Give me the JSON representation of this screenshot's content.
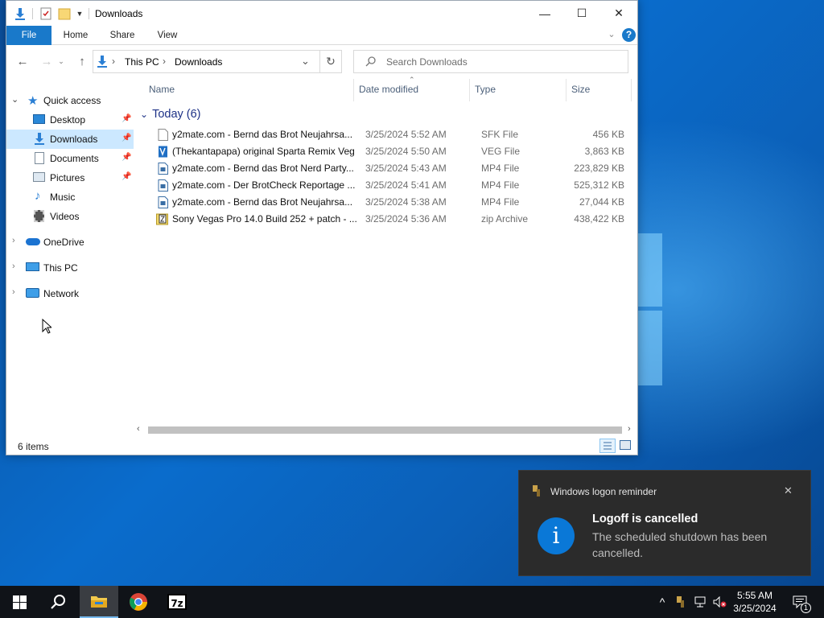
{
  "window": {
    "title": "Downloads",
    "minimize_glyph": "—",
    "maximize_glyph": "☐",
    "close_glyph": "✕"
  },
  "ribbon": {
    "tabs": [
      {
        "label": "File"
      },
      {
        "label": "Home"
      },
      {
        "label": "Share"
      },
      {
        "label": "View"
      }
    ]
  },
  "address": {
    "crumbs": [
      "This PC",
      "Downloads"
    ],
    "separator": "›"
  },
  "search": {
    "placeholder": "Search Downloads"
  },
  "nav_pane": {
    "items": [
      {
        "label": "Quick access",
        "icon": "star-icon",
        "pinned": false
      },
      {
        "label": "Desktop",
        "icon": "desktop-icon",
        "pinned": true
      },
      {
        "label": "Downloads",
        "icon": "download-icon",
        "pinned": true,
        "selected": true
      },
      {
        "label": "Documents",
        "icon": "documents-icon",
        "pinned": true
      },
      {
        "label": "Pictures",
        "icon": "pictures-icon",
        "pinned": true
      },
      {
        "label": "Music",
        "icon": "music-icon",
        "pinned": false
      },
      {
        "label": "Videos",
        "icon": "videos-icon",
        "pinned": false
      },
      {
        "label": "OneDrive",
        "icon": "onedrive-icon",
        "pinned": false
      },
      {
        "label": "This PC",
        "icon": "this-pc-icon",
        "pinned": false
      },
      {
        "label": "Network",
        "icon": "network-icon",
        "pinned": false
      }
    ]
  },
  "columns": {
    "name": "Name",
    "date": "Date modified",
    "type": "Type",
    "size": "Size"
  },
  "group": {
    "label": "Today (6)"
  },
  "files": [
    {
      "name": "y2mate.com - Bernd das Brot  Neujahrsa...",
      "date": "3/25/2024 5:52 AM",
      "type": "SFK File",
      "size": "456 KB",
      "icon": "file-icon"
    },
    {
      "name": "(Thekantapapa) original Sparta Remix Veg",
      "date": "3/25/2024 5:50 AM",
      "type": "VEG File",
      "size": "3,863 KB",
      "icon": "vegas-project-icon"
    },
    {
      "name": "y2mate.com - Bernd das Brot  Nerd Party...",
      "date": "3/25/2024 5:43 AM",
      "type": "MP4 File",
      "size": "223,829 KB",
      "icon": "video-file-icon"
    },
    {
      "name": "y2mate.com - Der BrotCheck  Reportage ...",
      "date": "3/25/2024 5:41 AM",
      "type": "MP4 File",
      "size": "525,312 KB",
      "icon": "video-file-icon"
    },
    {
      "name": "y2mate.com - Bernd das Brot  Neujahrsa...",
      "date": "3/25/2024 5:38 AM",
      "type": "MP4 File",
      "size": "27,044 KB",
      "icon": "video-file-icon"
    },
    {
      "name": "Sony Vegas Pro 14.0 Build 252 + patch - ...",
      "date": "3/25/2024 5:36 AM",
      "type": "zip Archive",
      "size": "438,422 KB",
      "icon": "zip-icon"
    }
  ],
  "status": {
    "items": "6 items"
  },
  "toast": {
    "app": "Windows logon reminder",
    "title": "Logoff is cancelled",
    "body": "The scheduled shutdown has been cancelled.",
    "info_glyph": "i",
    "close_glyph": "✕"
  },
  "taskbar": {
    "apps": [
      {
        "name": "start-button",
        "icon": "windows-icon"
      },
      {
        "name": "search-button",
        "icon": "search-icon"
      },
      {
        "name": "file-explorer-app",
        "icon": "folder-icon",
        "active": true
      },
      {
        "name": "chrome-app",
        "icon": "chrome-icon"
      },
      {
        "name": "7zip-app",
        "icon": "7zip-icon",
        "label": "7z"
      }
    ],
    "clock_time": "5:55 AM",
    "clock_date": "3/25/2024",
    "notification_count": "1",
    "tray_chevron": "^"
  },
  "colors": {
    "accent": "#1979ca",
    "selection": "#cce8ff",
    "group_header": "#1e3287",
    "toast_bg": "#2b2b2b",
    "taskbar_bg": "#101318"
  }
}
